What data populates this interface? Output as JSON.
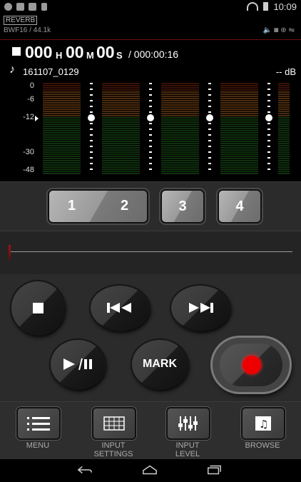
{
  "status_bar": {
    "time": "10:09"
  },
  "header": {
    "reverb_label": "REVERB",
    "format": "BWF16 / 44.1k"
  },
  "time": {
    "hours": "000",
    "h_unit": "H",
    "minutes": "00",
    "m_unit": "M",
    "seconds": "00",
    "s_unit": "S",
    "total": "/ 000:00:16"
  },
  "file": {
    "name": "161107_0129",
    "level_db": "-- dB"
  },
  "meter": {
    "scale": [
      "0",
      "-6",
      "-12",
      "-30",
      "-48"
    ],
    "fader_level_db": -12
  },
  "channels": {
    "ch1": "1",
    "ch2": "2",
    "ch3": "3",
    "ch4": "4"
  },
  "position": {
    "progress": 0.0
  },
  "transport": {
    "mark_label": "MARK"
  },
  "menu": {
    "menu_label": "MENU",
    "input_settings_label": "INPUT\nSETTINGS",
    "input_level_label": "INPUT\nLEVEL",
    "browse_label": "BROWSE"
  },
  "colors": {
    "accent": "#e00000",
    "background": "#2b2b2b"
  }
}
